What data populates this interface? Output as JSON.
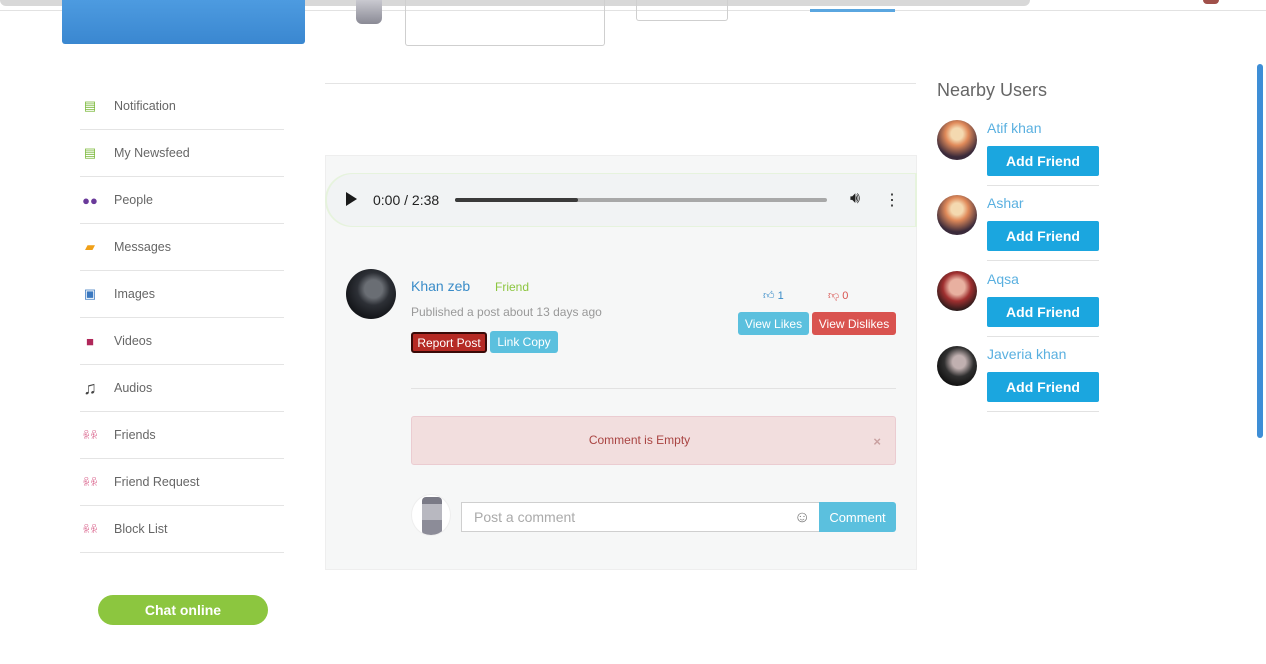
{
  "sidebar": {
    "items": [
      {
        "label": "Notification",
        "icon": "notification-icon"
      },
      {
        "label": "My Newsfeed",
        "icon": "newsfeed-icon"
      },
      {
        "label": "People",
        "icon": "people-icon"
      },
      {
        "label": "Messages",
        "icon": "messages-icon"
      },
      {
        "label": "Images",
        "icon": "images-icon"
      },
      {
        "label": "Videos",
        "icon": "videos-icon"
      },
      {
        "label": "Audios",
        "icon": "music-note-icon"
      },
      {
        "label": "Friends",
        "icon": "friends-icon"
      },
      {
        "label": "Friend Request",
        "icon": "friend-request-icon"
      },
      {
        "label": "Block List",
        "icon": "block-list-icon"
      }
    ],
    "chat_online": "Chat online"
  },
  "audio": {
    "time": "0:00 / 2:38",
    "progress_fraction": 0.33
  },
  "post": {
    "author": "Khan zeb",
    "relation": "Friend",
    "meta": "Published a post about 13 days ago",
    "report_label": "Report Post",
    "link_copy_label": "Link Copy",
    "likes": "1",
    "dislikes": "0",
    "view_likes_label": "View Likes",
    "view_dislikes_label": "View Dislikes"
  },
  "alert": {
    "text": "Comment is Empty",
    "close": "×"
  },
  "comment": {
    "placeholder": "Post a comment",
    "button": "Comment"
  },
  "nearby": {
    "title": "Nearby Users",
    "users": [
      {
        "name": "Atif khan",
        "button": "Add Friend"
      },
      {
        "name": "Ashar",
        "button": "Add Friend"
      },
      {
        "name": "Aqsa",
        "button": "Add Friend"
      },
      {
        "name": "Javeria khan",
        "button": "Add Friend"
      }
    ]
  },
  "colors": {
    "accent_blue": "#1ba6df",
    "info": "#5bc0de",
    "danger": "#d9534f",
    "green": "#8cc63f"
  }
}
